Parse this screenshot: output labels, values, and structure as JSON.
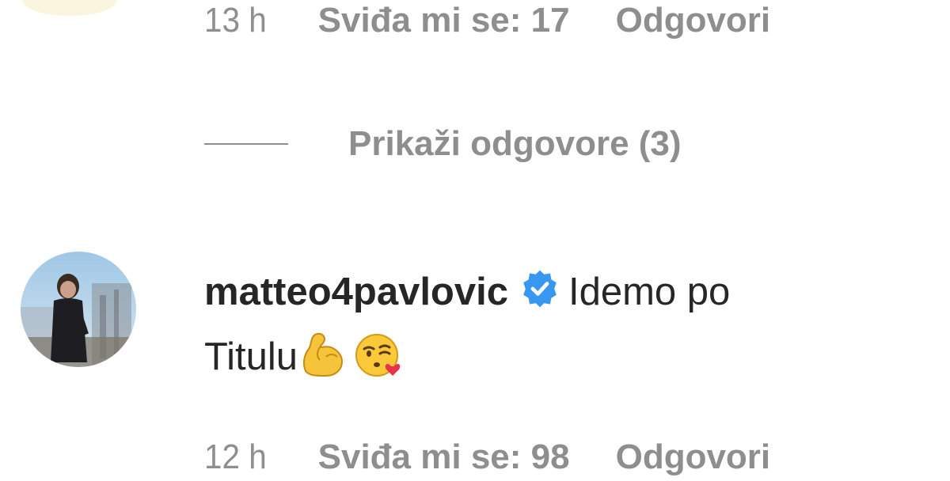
{
  "previous_comment": {
    "time": "13 h",
    "likes": "Sviđa mi se: 17",
    "reply": "Odgovori",
    "view_replies": "Prikaži odgovore (3)"
  },
  "comment": {
    "username": "matteo4pavlovic",
    "verified_icon": "verified-badge-icon",
    "text_before": "Idemo po",
    "text_line2": "Titulu",
    "emojis": [
      "flexed-biceps-emoji",
      "face-blowing-kiss-emoji"
    ],
    "time": "12 h",
    "likes": "Sviđa mi se: 98",
    "reply": "Odgovori"
  },
  "colors": {
    "meta_gray": "#8e8e8e",
    "text_dark": "#262626",
    "verified_blue": "#3897f0"
  }
}
